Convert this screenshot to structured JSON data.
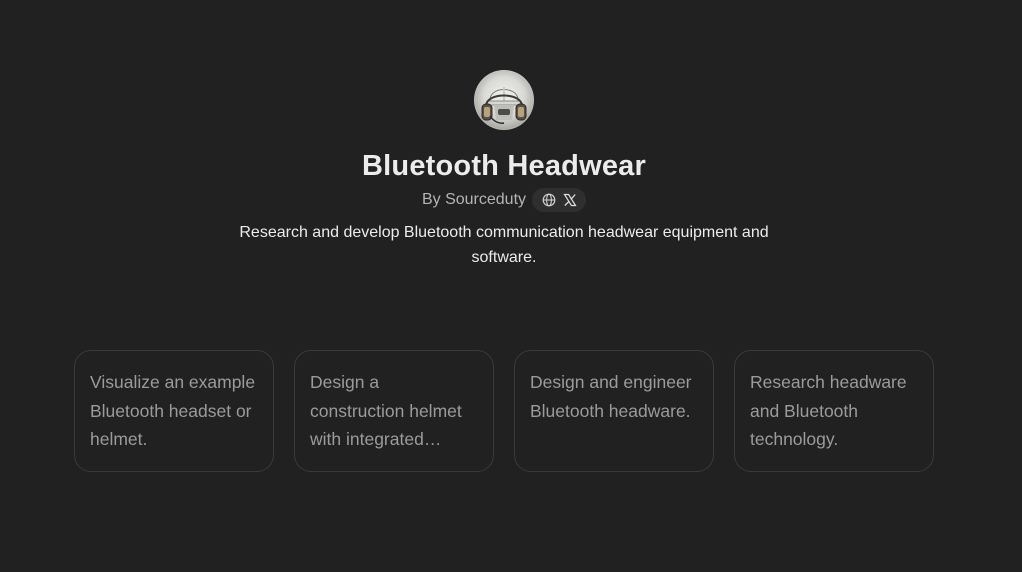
{
  "gpt": {
    "avatar_icon": "bluetooth-helmet-headset-icon",
    "name": "Bluetooth Headwear",
    "byline": "By Sourceduty",
    "social_icons": [
      "globe-icon",
      "x-icon"
    ],
    "description": "Research and develop Bluetooth communication headwear equipment and software."
  },
  "conversation_starters": [
    "Visualize an example Bluetooth headset or helmet.",
    "Design a construction helmet with integrated Bluetooth speakers.",
    "Design and engineer Bluetooth headware.",
    "Research headware and Bluetooth technology."
  ],
  "colors": {
    "background": "#212121",
    "text_primary": "#ececec",
    "text_secondary": "#b4b4b4",
    "card_text": "#9b9b9b",
    "card_border": "#3a3a3a",
    "chip_background": "#2f2f2f"
  }
}
